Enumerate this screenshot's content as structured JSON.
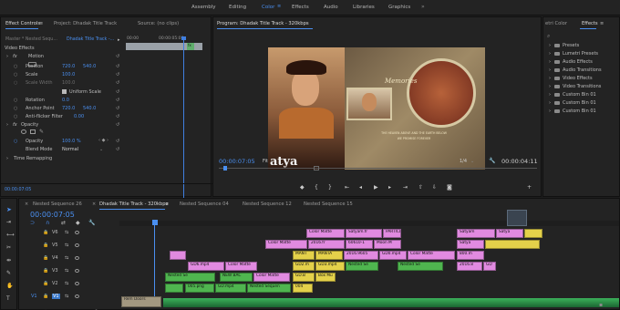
{
  "workspaces": [
    "Assembly",
    "Editing",
    "Color",
    "Effects",
    "Audio",
    "Libraries",
    "Graphics"
  ],
  "active_workspace": "Color",
  "source_panel": {
    "tabs": [
      "Effect Controls",
      "Project: Dhadak Title Track",
      "Source: (no clips)"
    ],
    "master_label": "Master * Nested Sequ...",
    "sequence_label": "Dhadak Title Track -...",
    "timecode_start": "00:00",
    "timecode_mark": "00:00:05:00",
    "section_video": "Video Effects",
    "effects": [
      {
        "label": "Motion"
      },
      {
        "label": "Position",
        "v1": "720.0",
        "v2": "540.0"
      },
      {
        "label": "Scale",
        "v1": "100.0"
      },
      {
        "label": "Scale Width",
        "v1": "100.0"
      },
      {
        "label": "Uniform Scale"
      },
      {
        "label": "Rotation",
        "v1": "0.0"
      },
      {
        "label": "Anchor Point",
        "v1": "720.0",
        "v2": "540.0"
      },
      {
        "label": "Anti-flicker Filter",
        "v1": "0.00"
      },
      {
        "label": "Opacity"
      },
      {
        "label": "Opacity",
        "v1": "100.0 %"
      },
      {
        "label": "Blend Mode",
        "v1": "Normal"
      },
      {
        "label": "Time Remapping"
      }
    ],
    "clip_name": "Dhadak Title Track",
    "timecode": "00:00:07:05"
  },
  "program_monitor": {
    "title": "Program: Dhadak Title Track - 320kbps",
    "timecode": "00:00:07:05",
    "fit": "Fit",
    "resolution": "1/4",
    "duration": "00:00:04:11",
    "image_title": "Memories",
    "image_caption_1": "THE HEAVEN ABOVE AND THE EARTH BELOW",
    "image_caption_2": "WE PROMISE FOREVER",
    "brand_text": "atya"
  },
  "effects_panel": {
    "tabs": [
      "etri Color",
      "Effects"
    ],
    "folders": [
      "Presets",
      "Lumetri Presets",
      "Audio Effects",
      "Audio Transitions",
      "Video Effects",
      "Video Transitions",
      "Custom Bin 01",
      "Custom Bin 01",
      "Custom Bin 01"
    ]
  },
  "timeline": {
    "tabs": [
      "Nested Sequence 26",
      "Dhadak Title Track - 320kbps",
      "Nested Sequence 04",
      "Nested Sequence 12",
      "Nested Sequence 15"
    ],
    "timecode": "00:00:07:05",
    "tracks": [
      "V6",
      "V5",
      "V4",
      "V3",
      "V2",
      "V1"
    ],
    "bottom_clip": "Rem Doors",
    "clips": [
      {
        "label": "Color Matte"
      },
      {
        "label": "Satyam.fr"
      },
      {
        "label": "PARTICLE"
      },
      {
        "label": "Satyam"
      },
      {
        "label": "Satya"
      },
      {
        "label": "Color Matte"
      },
      {
        "label": "2016.fr"
      },
      {
        "label": "60610-1"
      },
      {
        "label": "Moon M"
      },
      {
        "label": "Satya"
      },
      {
        "label": "MANT"
      },
      {
        "label": "MANTA"
      },
      {
        "label": "2016.9605"
      },
      {
        "label": "GD0.mp4"
      },
      {
        "label": "Color Matte"
      },
      {
        "label": "800.m"
      },
      {
        "label": "GD6.mp4"
      },
      {
        "label": "Color Matte"
      },
      {
        "label": "GD2.m"
      },
      {
        "label": "GD3.mp4"
      },
      {
        "label": "Nested Se"
      },
      {
        "label": "Nested Se"
      },
      {
        "label": "2016.8"
      },
      {
        "label": "GD"
      },
      {
        "label": "Nested Se"
      },
      {
        "label": "NEW BAC"
      },
      {
        "label": "Color Matte"
      },
      {
        "label": "GD.B"
      },
      {
        "label": "Box Mu"
      },
      {
        "label": "005.png"
      },
      {
        "label": "GD.mp4"
      },
      {
        "label": "Nested Sequen"
      },
      {
        "label": "004"
      }
    ]
  }
}
